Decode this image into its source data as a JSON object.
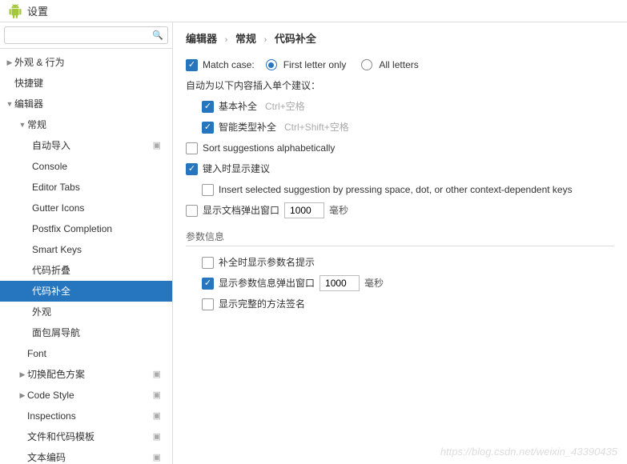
{
  "window": {
    "title": "设置"
  },
  "search": {
    "placeholder": ""
  },
  "tree": {
    "appearance": "外观 & 行为",
    "keymap": "快捷键",
    "editor": "编辑器",
    "general": "常规",
    "auto_import": "自动导入",
    "console": "Console",
    "editor_tabs": "Editor Tabs",
    "gutter_icons": "Gutter Icons",
    "postfix": "Postfix Completion",
    "smart_keys": "Smart Keys",
    "code_folding": "代码折叠",
    "code_completion": "代码补全",
    "look": "外观",
    "breadcrumbs": "面包屑导航",
    "font": "Font",
    "color_scheme": "切换配色方案",
    "code_style": "Code Style",
    "inspections": "Inspections",
    "file_templates": "文件和代码模板",
    "file_encoding": "文本编码"
  },
  "breadcrumb": {
    "editor": "编辑器",
    "general": "常规",
    "code_completion": "代码补全"
  },
  "form": {
    "match_case": "Match case:",
    "first_letter": "First letter only",
    "all_letters": "All letters",
    "auto_insert_label": "自动为以下内容插入单个建议：",
    "basic": "基本补全",
    "basic_sc": "Ctrl+空格",
    "smart_type": "智能类型补全",
    "smart_type_sc": "Ctrl+Shift+空格",
    "sort_alpha": "Sort suggestions alphabetically",
    "show_on_type": "键入时显示建议",
    "insert_by_space": "Insert selected suggestion by pressing space, dot, or other context-dependent keys",
    "show_doc_popup": "显示文档弹出窗口",
    "doc_popup_value": "1000",
    "ms": "毫秒",
    "param_info_section": "参数信息",
    "show_param_name": "补全时显示参数名提示",
    "show_param_popup": "显示参数信息弹出窗口",
    "param_popup_value": "1000",
    "show_full_sig": "显示完整的方法签名"
  },
  "watermark": "https://blog.csdn.net/weixin_43390435"
}
